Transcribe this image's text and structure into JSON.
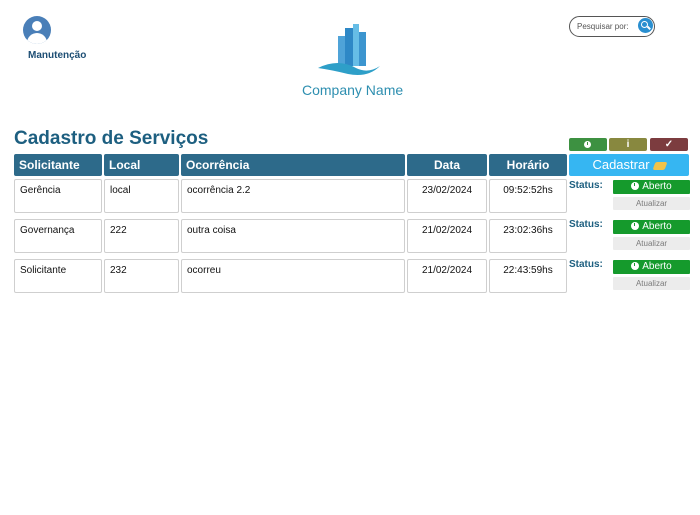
{
  "user": {
    "label": "Manutenção"
  },
  "logo": {
    "text": "Company Name"
  },
  "search": {
    "placeholder": "Pesquisar por:"
  },
  "page": {
    "title": "Cadastro de Serviços"
  },
  "table": {
    "headers": [
      "Solicitante",
      "Local",
      "Ocorrência",
      "Data",
      "Horário"
    ],
    "rows": [
      [
        "Gerência",
        "local",
        "ocorrência 2.2",
        "23/02/2024",
        "09:52:52hs"
      ],
      [
        "Governança",
        "222",
        "outra coisa",
        "21/02/2024",
        "23:02:36hs"
      ],
      [
        "Solicitante",
        "232",
        "ocorreu",
        "21/02/2024",
        "22:43:59hs"
      ]
    ]
  },
  "actions": {
    "filter_icons": [
      "clock-icon",
      "info-icon",
      "check-icon"
    ],
    "info_glyph": "i",
    "check_glyph": "✓",
    "cadastrar_label": "Cadastrar"
  },
  "status": {
    "label": "Status:",
    "value": "Aberto",
    "update_label": "Atualizar"
  },
  "colors": {
    "header_bg": "#2d6a8a",
    "title": "#1d5f80",
    "cadastrar": "#36b6f2",
    "status_open": "#159a2c"
  }
}
